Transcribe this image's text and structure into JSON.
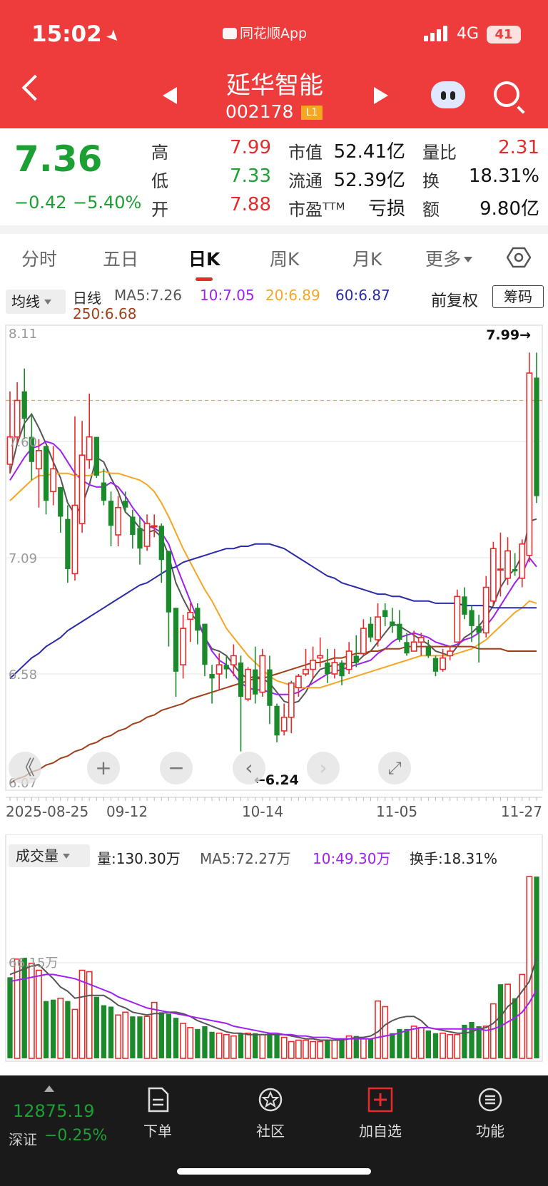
{
  "status_bar": {
    "time": "15:02",
    "app_name": "同花顺App",
    "network": "4G",
    "battery": "41"
  },
  "header": {
    "stock_name": "延华智能",
    "stock_code": "002178",
    "level_badge": "L1"
  },
  "quote": {
    "price": "7.36",
    "change": "−0.42",
    "change_pct": "−5.40%",
    "high_label": "高",
    "high": "7.99",
    "low_label": "低",
    "low": "7.33",
    "open_label": "开",
    "open": "7.88",
    "mcap_label": "市值",
    "mcap": "52.41亿",
    "float_label": "流通",
    "float": "52.39亿",
    "pe_label": "市盈ᵀᵀᴹ",
    "pe": "亏损",
    "vol_ratio_label": "量比",
    "vol_ratio": "2.31",
    "turnover_label": "换",
    "turnover": "18.31%",
    "amount_label": "额",
    "amount": "9.80亿"
  },
  "tabs": [
    "分时",
    "五日",
    "日K",
    "周K",
    "月K",
    "更多"
  ],
  "active_tab": "日K",
  "ma_legend": {
    "selector": "均线",
    "line_label": "日线",
    "ma5": "MA5:7.26",
    "ma10": "10:7.05",
    "ma20": "20:6.89",
    "ma60": "60:6.87",
    "ma250": "250:6.68",
    "adjust": "前复权",
    "chips_button": "筹码"
  },
  "colors": {
    "up": "#e52b2b",
    "down": "#1a8a2a",
    "ma5": "#555555",
    "ma10": "#a020f0",
    "ma20": "#f5a623",
    "ma60": "#2b2ba8",
    "ma250": "#a0401a",
    "header": "#ee3b3b"
  },
  "chart_data": {
    "type": "candlestick",
    "y_ticks": [
      "8.11",
      "7.60",
      "7.09",
      "6.58",
      "6.07"
    ],
    "x_ticks": [
      "2025-08-25",
      "09-12",
      "10-14",
      "11-05",
      "11-27"
    ],
    "high_annotation": "7.99→",
    "low_annotation": "←6.24",
    "ylim": [
      6.07,
      8.11
    ],
    "candles": [
      [
        7.5,
        7.62,
        7.82,
        7.46
      ],
      [
        7.62,
        7.78,
        7.86,
        7.59
      ],
      [
        7.82,
        7.7,
        7.92,
        7.61
      ],
      [
        7.62,
        7.51,
        7.72,
        7.43
      ],
      [
        7.48,
        7.56,
        7.61,
        7.31
      ],
      [
        7.58,
        7.34,
        7.58,
        7.28
      ],
      [
        7.38,
        7.48,
        7.58,
        7.32
      ],
      [
        7.4,
        7.27,
        7.4,
        7.2
      ],
      [
        7.26,
        7.04,
        7.32,
        6.98
      ],
      [
        7.02,
        7.32,
        7.71,
        6.99
      ],
      [
        7.24,
        7.54,
        7.69,
        7.2
      ],
      [
        7.52,
        7.62,
        7.81,
        7.48
      ],
      [
        7.62,
        7.45,
        7.62,
        7.44
      ],
      [
        7.42,
        7.34,
        7.48,
        7.32
      ],
      [
        7.34,
        7.23,
        7.38,
        7.14
      ],
      [
        7.19,
        7.31,
        7.36,
        7.14
      ],
      [
        7.34,
        7.31,
        7.38,
        7.29
      ],
      [
        7.27,
        7.19,
        7.3,
        7.13
      ],
      [
        7.22,
        7.13,
        7.27,
        7.06
      ],
      [
        7.14,
        7.24,
        7.28,
        7.12
      ],
      [
        7.23,
        7.23,
        7.28,
        7.18
      ],
      [
        7.23,
        7.08,
        7.24,
        6.98
      ],
      [
        7.12,
        6.85,
        7.12,
        6.7
      ],
      [
        6.87,
        6.59,
        6.87,
        6.48
      ],
      [
        6.62,
        6.78,
        6.84,
        6.56
      ],
      [
        6.82,
        6.85,
        6.89,
        6.72
      ],
      [
        6.87,
        6.77,
        6.89,
        6.71
      ],
      [
        6.8,
        6.62,
        6.8,
        6.57
      ],
      [
        6.58,
        6.56,
        6.62,
        6.45
      ],
      [
        6.58,
        6.62,
        6.67,
        6.51
      ],
      [
        6.62,
        6.6,
        6.66,
        6.56
      ],
      [
        6.62,
        6.66,
        6.71,
        6.57
      ],
      [
        6.63,
        6.48,
        6.66,
        6.24
      ],
      [
        6.47,
        6.6,
        6.61,
        6.46
      ],
      [
        6.6,
        6.49,
        6.7,
        6.45
      ],
      [
        6.5,
        6.66,
        6.69,
        6.48
      ],
      [
        6.6,
        6.44,
        6.66,
        6.36
      ],
      [
        6.44,
        6.31,
        6.45,
        6.28
      ],
      [
        6.33,
        6.39,
        6.45,
        6.31
      ],
      [
        6.39,
        6.54,
        6.55,
        6.32
      ],
      [
        6.52,
        6.57,
        6.58,
        6.48
      ],
      [
        6.58,
        6.6,
        6.69,
        6.57
      ],
      [
        6.6,
        6.64,
        6.7,
        6.56
      ],
      [
        6.65,
        6.66,
        6.74,
        6.61
      ],
      [
        6.63,
        6.58,
        6.69,
        6.54
      ],
      [
        6.58,
        6.63,
        6.69,
        6.56
      ],
      [
        6.63,
        6.57,
        6.64,
        6.53
      ],
      [
        6.6,
        6.68,
        6.72,
        6.58
      ],
      [
        6.66,
        6.63,
        6.75,
        6.61
      ],
      [
        6.67,
        6.78,
        6.82,
        6.66
      ],
      [
        6.8,
        6.74,
        6.83,
        6.72
      ],
      [
        6.73,
        6.83,
        6.89,
        6.7
      ],
      [
        6.86,
        6.83,
        6.89,
        6.79
      ],
      [
        6.81,
        6.79,
        6.87,
        6.76
      ],
      [
        6.8,
        6.73,
        6.86,
        6.72
      ],
      [
        6.72,
        6.67,
        6.76,
        6.66
      ],
      [
        6.68,
        6.72,
        6.77,
        6.69
      ],
      [
        6.72,
        6.74,
        6.76,
        6.66
      ],
      [
        6.7,
        6.66,
        6.73,
        6.65
      ],
      [
        6.65,
        6.59,
        6.66,
        6.57
      ],
      [
        6.6,
        6.65,
        6.69,
        6.59
      ],
      [
        6.66,
        6.68,
        6.7,
        6.64
      ],
      [
        6.72,
        6.92,
        6.95,
        6.72
      ],
      [
        6.92,
        6.84,
        6.96,
        6.82
      ],
      [
        6.86,
        6.79,
        6.88,
        6.72
      ],
      [
        6.79,
        6.76,
        6.84,
        6.63
      ],
      [
        6.76,
        6.96,
        7.01,
        6.74
      ],
      [
        6.9,
        7.13,
        7.16,
        6.88
      ],
      [
        7.04,
        7.04,
        7.2,
        6.92
      ],
      [
        7.0,
        7.12,
        7.18,
        6.97
      ],
      [
        7.04,
        7.03,
        7.11,
        7.01
      ],
      [
        7.0,
        7.15,
        7.17,
        6.96
      ],
      [
        7.1,
        7.9,
        7.99,
        7.07
      ],
      [
        7.88,
        7.36,
        7.99,
        7.33
      ]
    ],
    "ma_series": [
      {
        "name": "MA5",
        "values": [
          7.46,
          7.59,
          7.68,
          7.72,
          7.66,
          7.59,
          7.51,
          7.44,
          7.33,
          7.28,
          7.32,
          7.41,
          7.53,
          7.51,
          7.44,
          7.38,
          7.29,
          7.26,
          7.22,
          7.2,
          7.21,
          7.18,
          7.1,
          6.98,
          6.91,
          6.85,
          6.81,
          6.74,
          6.69,
          6.68,
          6.66,
          6.62,
          6.58,
          6.56,
          6.57,
          6.56,
          6.54,
          6.5,
          6.46,
          6.45,
          6.46,
          6.5,
          6.56,
          6.6,
          6.61,
          6.62,
          6.62,
          6.63,
          6.63,
          6.66,
          6.68,
          6.72,
          6.76,
          6.8,
          6.79,
          6.77,
          6.75,
          6.73,
          6.71,
          6.68,
          6.67,
          6.66,
          6.7,
          6.74,
          6.76,
          6.79,
          6.83,
          6.88,
          6.96,
          7.01,
          7.04,
          7.1,
          7.25,
          7.26
        ]
      },
      {
        "name": "MA10",
        "values": [
          7.43,
          7.48,
          7.53,
          7.57,
          7.58,
          7.6,
          7.59,
          7.56,
          7.51,
          7.46,
          7.43,
          7.41,
          7.4,
          7.4,
          7.42,
          7.4,
          7.36,
          7.31,
          7.27,
          7.23,
          7.22,
          7.2,
          7.15,
          7.06,
          6.98,
          6.9,
          6.82,
          6.74,
          6.68,
          6.64,
          6.62,
          6.58,
          6.54,
          6.52,
          6.51,
          6.51,
          6.5,
          6.49,
          6.49,
          6.49,
          6.5,
          6.52,
          6.54,
          6.56,
          6.58,
          6.59,
          6.6,
          6.61,
          6.62,
          6.63,
          6.64,
          6.67,
          6.69,
          6.72,
          6.74,
          6.75,
          6.76,
          6.75,
          6.74,
          6.72,
          6.71,
          6.7,
          6.71,
          6.73,
          6.74,
          6.76,
          6.79,
          6.83,
          6.88,
          6.93,
          6.98,
          7.02,
          7.09,
          7.05
        ]
      },
      {
        "name": "MA20",
        "values": [
          7.34,
          7.37,
          7.4,
          7.43,
          7.45,
          7.45,
          7.46,
          7.46,
          7.46,
          7.45,
          7.45,
          7.45,
          7.46,
          7.47,
          7.46,
          7.46,
          7.45,
          7.44,
          7.43,
          7.41,
          7.38,
          7.33,
          7.27,
          7.2,
          7.13,
          7.07,
          7.01,
          6.95,
          6.9,
          6.84,
          6.78,
          6.74,
          6.7,
          6.66,
          6.63,
          6.6,
          6.57,
          6.55,
          6.54,
          6.53,
          6.52,
          6.52,
          6.52,
          6.52,
          6.53,
          6.54,
          6.55,
          6.56,
          6.57,
          6.58,
          6.59,
          6.6,
          6.61,
          6.62,
          6.63,
          6.64,
          6.65,
          6.66,
          6.66,
          6.66,
          6.66,
          6.66,
          6.67,
          6.68,
          6.69,
          6.71,
          6.73,
          6.76,
          6.79,
          6.82,
          6.85,
          6.87,
          6.9,
          6.89
        ]
      },
      {
        "name": "MA60",
        "values": [
          6.56,
          6.59,
          6.62,
          6.65,
          6.67,
          6.7,
          6.72,
          6.74,
          6.77,
          6.79,
          6.81,
          6.83,
          6.85,
          6.87,
          6.89,
          6.91,
          6.93,
          6.95,
          6.97,
          6.98,
          7.0,
          7.02,
          7.04,
          7.05,
          7.07,
          7.08,
          7.09,
          7.1,
          7.11,
          7.12,
          7.13,
          7.13,
          7.14,
          7.14,
          7.15,
          7.15,
          7.15,
          7.14,
          7.13,
          7.11,
          7.09,
          7.07,
          7.05,
          7.03,
          7.01,
          7.0,
          6.98,
          6.97,
          6.96,
          6.95,
          6.94,
          6.93,
          6.93,
          6.92,
          6.92,
          6.91,
          6.9,
          6.9,
          6.9,
          6.89,
          6.89,
          6.89,
          6.89,
          6.88,
          6.88,
          6.88,
          6.88,
          6.87,
          6.87,
          6.87,
          6.87,
          6.87,
          6.87,
          6.87
        ]
      },
      {
        "name": "MA250",
        "values": [
          6.1,
          6.12,
          6.13,
          6.15,
          6.16,
          6.18,
          6.19,
          6.21,
          6.22,
          6.24,
          6.25,
          6.27,
          6.28,
          6.3,
          6.31,
          6.33,
          6.34,
          6.36,
          6.37,
          6.39,
          6.4,
          6.42,
          6.43,
          6.44,
          6.45,
          6.47,
          6.48,
          6.49,
          6.5,
          6.51,
          6.52,
          6.53,
          6.54,
          6.55,
          6.56,
          6.56,
          6.57,
          6.58,
          6.59,
          6.6,
          6.61,
          6.62,
          6.63,
          6.63,
          6.64,
          6.65,
          6.65,
          6.66,
          6.67,
          6.67,
          6.68,
          6.68,
          6.69,
          6.69,
          6.69,
          6.7,
          6.7,
          6.7,
          6.7,
          6.7,
          6.7,
          6.7,
          6.7,
          6.7,
          6.7,
          6.69,
          6.69,
          6.69,
          6.69,
          6.68,
          6.68,
          6.68,
          6.68,
          6.68
        ]
      }
    ],
    "volume": {
      "label": "成交量",
      "vol_text": "量:130.30万",
      "ma5_text": "MA5:72.27万",
      "ma10_text": "10:49.30万",
      "turnover_text": "换手:18.31%",
      "y_tick": "66.15万",
      "values": [
        58,
        71,
        72,
        68,
        63,
        41,
        42,
        43,
        41,
        35,
        63,
        62,
        44,
        38,
        37,
        31,
        33,
        30,
        30,
        30,
        40,
        33,
        32,
        29,
        25,
        22,
        21,
        23,
        19,
        18,
        17,
        16,
        18,
        18,
        18,
        17,
        18,
        17,
        15,
        12,
        13,
        13,
        12,
        12,
        13,
        13,
        14,
        16,
        16,
        14,
        14,
        41,
        37,
        18,
        21,
        21,
        23,
        22,
        20,
        18,
        18,
        17,
        17,
        24,
        26,
        23,
        23,
        39,
        53,
        53,
        43,
        60,
        130,
        130
      ],
      "up": [
        false,
        true,
        false,
        true,
        true,
        false,
        false,
        true,
        false,
        true,
        true,
        true,
        false,
        false,
        false,
        true,
        true,
        false,
        false,
        true,
        true,
        false,
        false,
        false,
        true,
        true,
        false,
        false,
        false,
        true,
        true,
        true,
        false,
        true,
        false,
        true,
        false,
        false,
        true,
        true,
        true,
        true,
        true,
        true,
        false,
        true,
        false,
        true,
        false,
        true,
        false,
        true,
        true,
        false,
        false,
        false,
        true,
        true,
        false,
        false,
        true,
        true,
        true,
        false,
        false,
        false,
        true,
        true,
        false,
        true,
        false,
        true,
        true,
        false
      ],
      "ma_series": [
        {
          "name": "MA5",
          "values": [
            60,
            62,
            64,
            66,
            67,
            62,
            57,
            51,
            48,
            43,
            44,
            45,
            45,
            45,
            42,
            38,
            36,
            33,
            32,
            31,
            32,
            32,
            33,
            33,
            32,
            30,
            27,
            25,
            23,
            21,
            19,
            18,
            18,
            17,
            17,
            17,
            17,
            17,
            17,
            16,
            15,
            14,
            14,
            13,
            13,
            13,
            13,
            14,
            15,
            15,
            16,
            19,
            24,
            27,
            29,
            30,
            30,
            27,
            22,
            21,
            20,
            19,
            18,
            18,
            19,
            21,
            22,
            25,
            30,
            37,
            41,
            48,
            55,
            72
          ]
        },
        {
          "name": "MA10",
          "values": [
            55,
            56,
            57,
            58,
            59,
            60,
            60,
            59,
            58,
            57,
            55,
            53,
            51,
            49,
            47,
            44,
            42,
            40,
            38,
            36,
            35,
            34,
            33,
            32,
            31,
            30,
            29,
            28,
            27,
            26,
            25,
            23,
            22,
            21,
            20,
            19,
            18,
            18,
            17,
            17,
            16,
            16,
            15,
            15,
            15,
            14,
            14,
            14,
            14,
            14,
            14,
            15,
            16,
            17,
            18,
            20,
            21,
            22,
            22,
            21,
            21,
            21,
            21,
            21,
            21,
            21,
            20,
            21,
            23,
            26,
            29,
            33,
            40,
            49
          ]
        }
      ]
    }
  },
  "controls": {
    "collapse": "《",
    "zoom_in": "+",
    "zoom_out": "−",
    "prev": "‹",
    "next": "›",
    "fullscreen": "⤢"
  },
  "bottom_nav": {
    "index_value": "12875.19",
    "index_name": "深证",
    "index_change": "−0.25%",
    "items": [
      "下单",
      "社区",
      "加自选",
      "功能"
    ]
  }
}
